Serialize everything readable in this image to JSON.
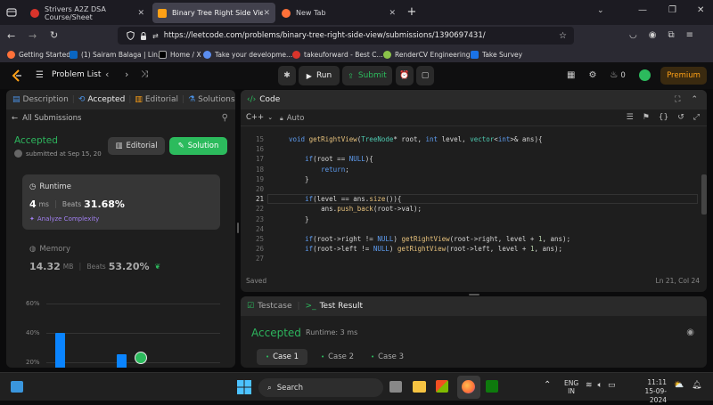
{
  "browser": {
    "tabs": [
      {
        "title": "Strivers A2Z DSA Course/Sheet",
        "active": false
      },
      {
        "title": "Binary Tree Right Side View - Le",
        "active": true
      },
      {
        "title": "New Tab",
        "active": false
      }
    ],
    "url": "https://leetcode.com/problems/binary-tree-right-side-view/submissions/1390697431/",
    "bookmarks": [
      "Getting Started",
      "(1) Sairam Balaga | Lin...",
      "Home / X",
      "Take your developme...",
      "takeuforward - Best C...",
      "RenderCV Engineering...",
      "Take Survey"
    ]
  },
  "leetcode_nav": {
    "problem_list": "Problem List",
    "run": "Run",
    "submit": "Submit",
    "coins": "0",
    "premium": "Premium"
  },
  "left_panel": {
    "tabs": [
      "Description",
      "Accepted",
      "Editorial",
      "Solutions"
    ],
    "all_submissions": "All Submissions",
    "status": "Accepted",
    "submitted": "submitted at Sep 15, 20",
    "editorial_button": "Editorial",
    "solution_button": "Solution",
    "runtime": {
      "label": "Runtime",
      "value": "4",
      "unit": "ms",
      "beats_label": "Beats",
      "beats_value": "31.68%",
      "analyze": "Analyze Complexity"
    },
    "memory": {
      "label": "Memory",
      "value": "14.32",
      "unit": "MB",
      "beats_label": "Beats",
      "beats_value": "53.20%"
    },
    "chart_axis": [
      "60%",
      "40%",
      "20%"
    ]
  },
  "code_panel": {
    "title": "Code",
    "language": "C++",
    "mode": "Auto",
    "saved": "Saved",
    "cursor": "Ln 21, Col 24",
    "lines": [
      {
        "n": "15",
        "t": "void getRightView(TreeNode* root, int level, vector<int>& ans){"
      },
      {
        "n": "16",
        "t": ""
      },
      {
        "n": "17",
        "t": "    if(root == NULL){"
      },
      {
        "n": "18",
        "t": "        return;"
      },
      {
        "n": "19",
        "t": "    }"
      },
      {
        "n": "20",
        "t": ""
      },
      {
        "n": "21",
        "t": "    if(level == ans.size()){"
      },
      {
        "n": "22",
        "t": "        ans.push_back(root->val);"
      },
      {
        "n": "23",
        "t": "    }"
      },
      {
        "n": "24",
        "t": ""
      },
      {
        "n": "25",
        "t": "    if(root->right != NULL) getRightView(root->right, level + 1, ans);"
      },
      {
        "n": "26",
        "t": "    if(root->left != NULL) getRightView(root->left, level + 1, ans);"
      },
      {
        "n": "27",
        "t": ""
      }
    ]
  },
  "result_panel": {
    "testcase_tab": "Testcase",
    "result_tab": "Test Result",
    "status": "Accepted",
    "runtime": "Runtime: 3 ms",
    "cases": [
      "Case 1",
      "Case 2",
      "Case 3"
    ]
  },
  "taskbar": {
    "search": "Search",
    "lang": "ENG",
    "region": "IN",
    "time": "11:11",
    "date": "15-09-2024"
  },
  "colors": {
    "accent_green": "#2cbb5d",
    "accent_blue": "#0a84ff",
    "accepted": "#2db55d",
    "premium": "#ffa116"
  }
}
